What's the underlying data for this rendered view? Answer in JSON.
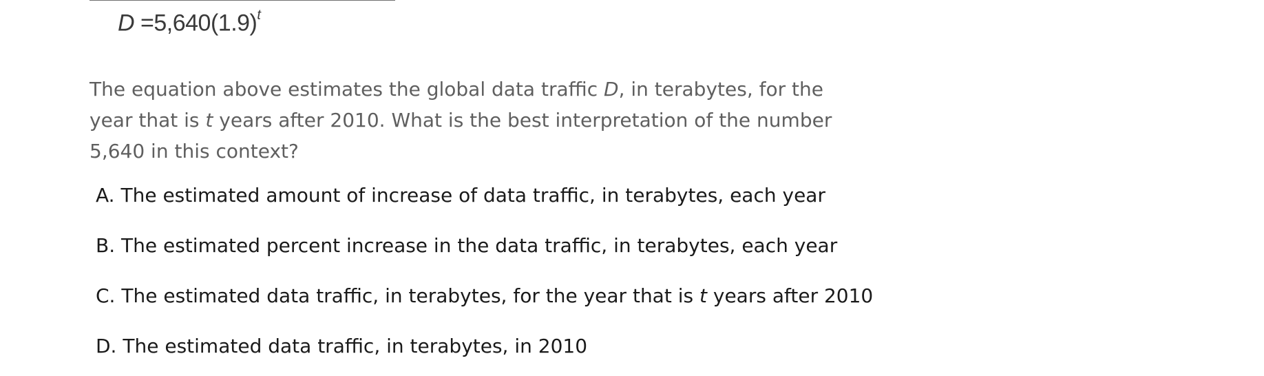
{
  "equation": {
    "lhs": "D",
    "equals": "=",
    "base": "5,640(1.9)",
    "exponent": "t"
  },
  "question": {
    "line1_pre": "The equation above estimates the global data traffic ",
    "line1_var": "D",
    "line1_post": ", in terabytes, for the",
    "line2_pre": "year that is ",
    "line2_var": "t",
    "line2_post": " years after 2010. What is the best interpretation of the number",
    "line3": "5,640 in this context?"
  },
  "choices": [
    {
      "letter": "A.",
      "text": "The estimated amount of increase of data traffic, in terabytes, each year"
    },
    {
      "letter": "B.",
      "text": "The estimated percent increase in the data traffic, in terabytes, each year"
    },
    {
      "letter": "C.",
      "text_pre": "The estimated data traffic, in terabytes, for the year that is ",
      "text_var": "t",
      "text_post": " years after 2010"
    },
    {
      "letter": "D.",
      "text": "The estimated data traffic, in terabytes, in 2010"
    }
  ]
}
